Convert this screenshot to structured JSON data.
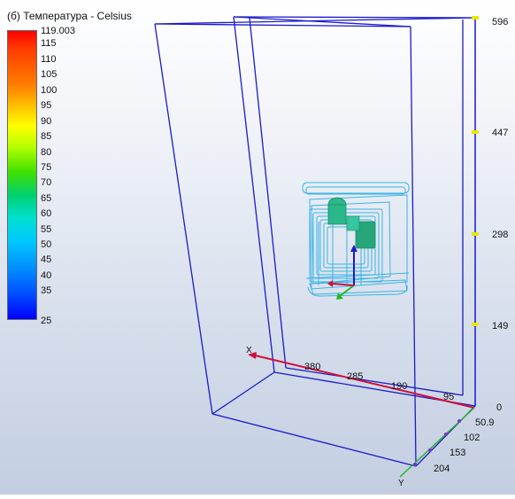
{
  "legend": {
    "title": "(б) Температура - Celsius",
    "ticks": [
      "119.003",
      "115",
      "110",
      "105",
      "100",
      "95",
      "90",
      "85",
      "80",
      "75",
      "70",
      "65",
      "60",
      "55",
      "50",
      "45",
      "40",
      "35",
      "25"
    ]
  },
  "axes": {
    "vertical_ticks": [
      "596",
      "447",
      "298",
      "149",
      "0"
    ],
    "x_ticks": [
      "380",
      "285",
      "190",
      "95"
    ],
    "y_ticks": [
      "50.9",
      "102",
      "153",
      "204"
    ],
    "x_label": "X",
    "y_label": "Y"
  },
  "colors": {
    "box_edges": "#1a1acc",
    "model_lines": "#38b4e8",
    "x_axis": "#d0103a",
    "y_axis": "#2ab52a",
    "tick_marks": "#e8e800"
  }
}
